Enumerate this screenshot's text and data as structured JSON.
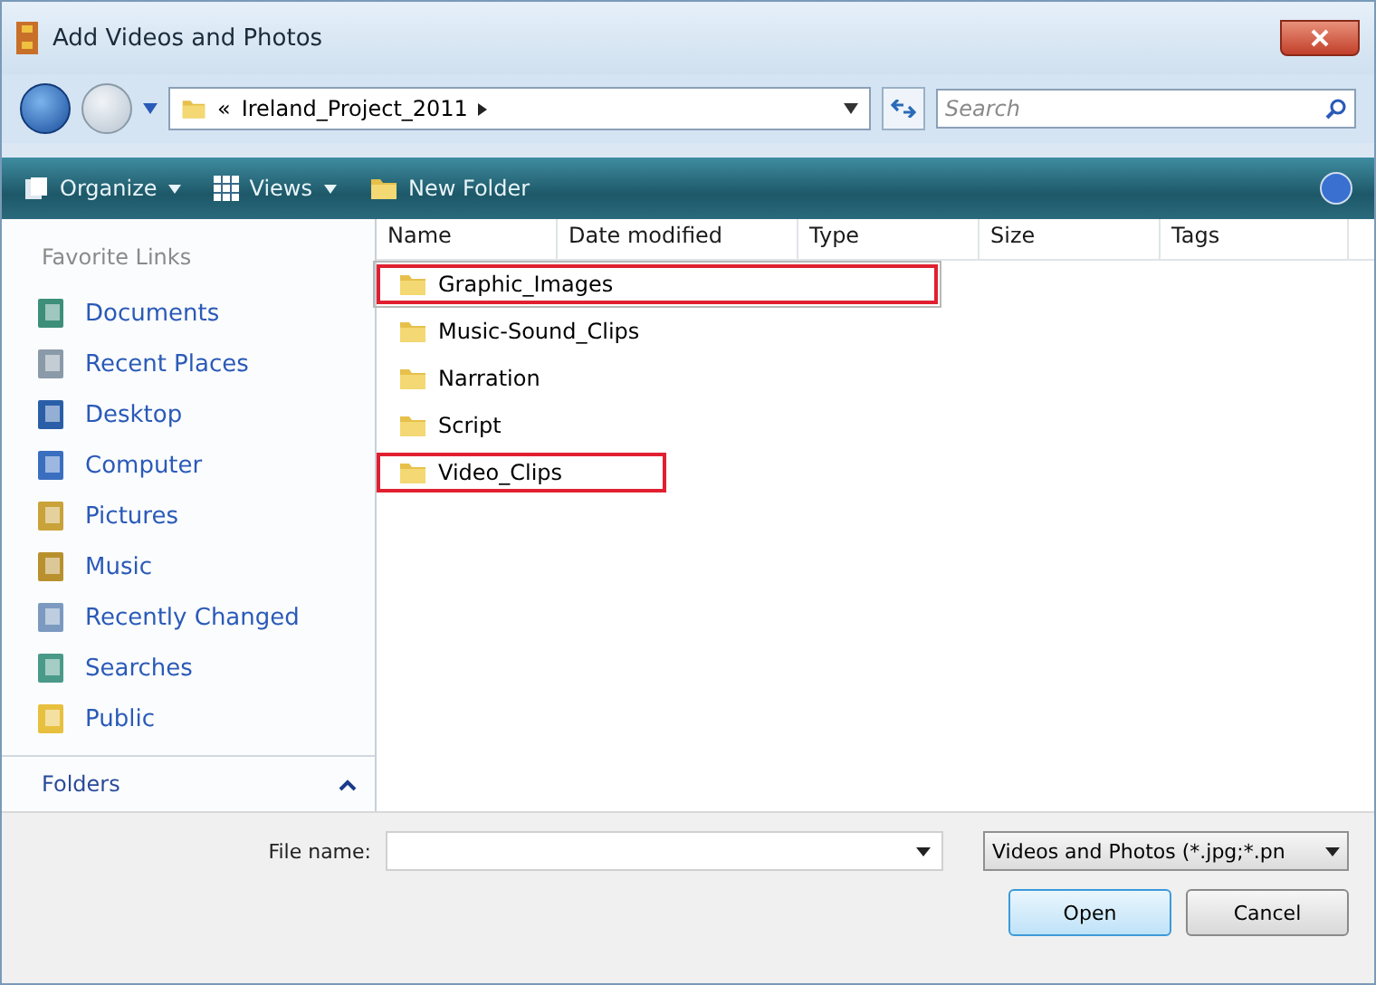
{
  "window": {
    "title": "Add Videos and Photos"
  },
  "address_bar": {
    "path": "Ireland_Project_2011",
    "overflow": "«"
  },
  "search": {
    "placeholder": "Search"
  },
  "toolbar": [
    "Organize",
    "Views",
    "New Folder"
  ],
  "sidebar": {
    "title": "Favorite Links",
    "items": [
      {
        "label": "Documents",
        "kind": "documents"
      },
      {
        "label": "Recent Places",
        "kind": "recent"
      },
      {
        "label": "Desktop",
        "kind": "desktop"
      },
      {
        "label": "Computer",
        "kind": "computer"
      },
      {
        "label": "Pictures",
        "kind": "pictures"
      },
      {
        "label": "Music",
        "kind": "music"
      },
      {
        "label": "Recently Changed",
        "kind": "changed"
      },
      {
        "label": "Searches",
        "kind": "searches"
      },
      {
        "label": "Public",
        "kind": "public"
      }
    ],
    "folders": {
      "label": "Folders",
      "expanded": true
    }
  },
  "table": {
    "columns": [
      "Name",
      "Date modified",
      "Type",
      "Size",
      "Tags"
    ],
    "rows": [
      {
        "name": "Graphic_Images",
        "selected": true,
        "highlighted": true
      },
      {
        "name": "Music-Sound_Clips",
        "selected": false,
        "highlighted": false
      },
      {
        "name": "Narration",
        "selected": false,
        "highlighted": false
      },
      {
        "name": "Script",
        "selected": false,
        "highlighted": false
      },
      {
        "name": "Video_Clips",
        "selected": false,
        "highlighted": true
      }
    ]
  },
  "file_name": {
    "label": "File name:"
  },
  "file_type": {
    "value": "Videos and Photos (*.jpg;*.pn"
  },
  "buttons": [
    "Open",
    "Cancel"
  ]
}
